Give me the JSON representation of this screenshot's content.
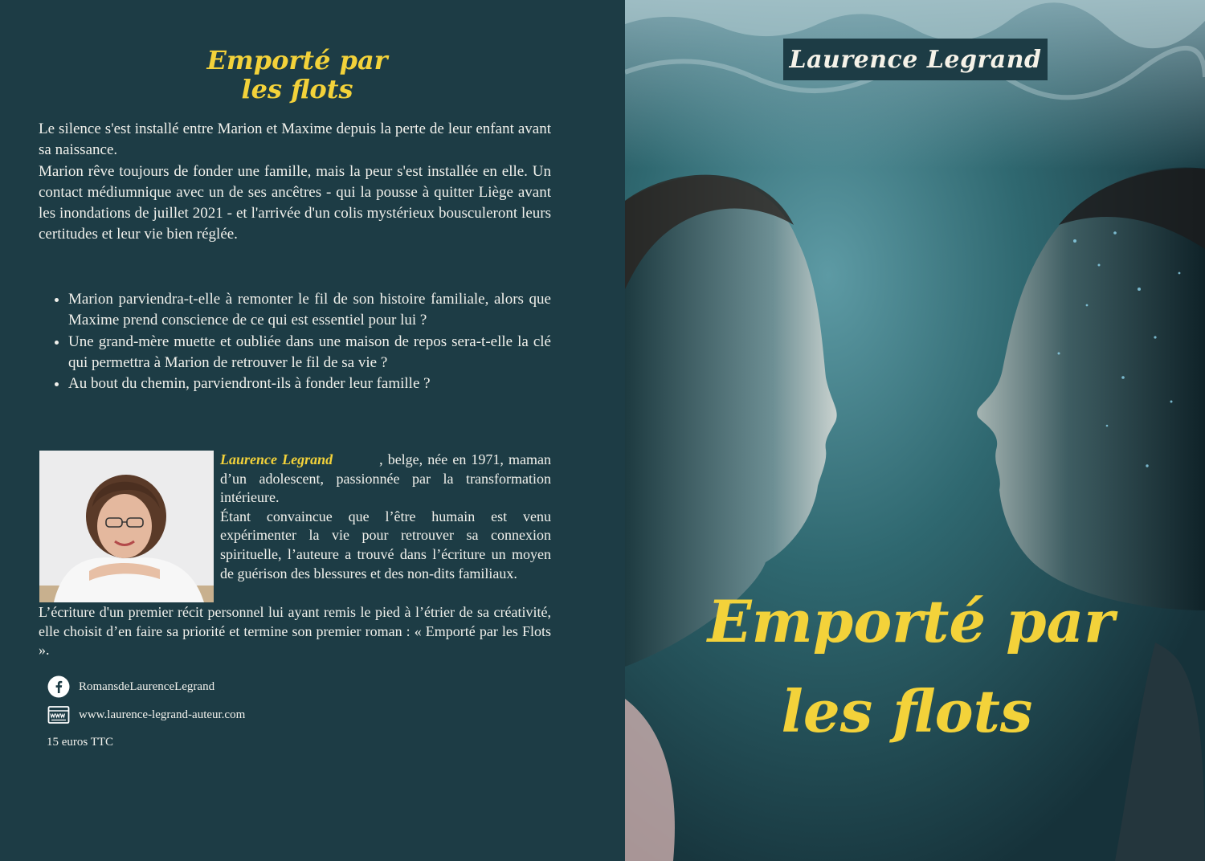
{
  "back": {
    "title_line1": "Emporté par",
    "title_line2": "les flots",
    "synopsis_p1": "Le silence s'est installé entre Marion et Maxime depuis la perte de leur enfant avant sa naissance.",
    "synopsis_p2": "Marion rêve toujours de fonder une famille, mais la peur s'est installée en elle. Un contact médiumnique avec un de ses ancêtres - qui la pousse à quitter Liège avant les inondations de juillet 2021 - et l'arrivée d'un colis mystérieux bousculeront leurs certitudes et leur vie bien réglée.",
    "questions": [
      "Marion parviendra-t-elle à remonter le fil de son histoire familiale, alors que Maxime prend conscience de ce qui est essentiel pour lui ?",
      "Une grand-mère muette et oubliée dans une maison de repos sera-t-elle la clé qui permettra à Marion de retrouver le fil de sa vie ?",
      "Au bout du chemin, parviendront-ils à fonder leur famille ?"
    ],
    "bio_name": "Laurence Legrand",
    "bio_intro": ", belge, née en 1971, maman d’un adolescent, passionnée par la transformation intérieure.",
    "bio_p2": "Étant convaincue que l’être humain est venu expérimenter la vie pour retrouver sa connexion spirituelle, l’auteure a trouvé dans l’écriture un moyen de guérison des blessures et des non-dits familiaux.",
    "bio_p3": "L’écriture d'un premier récit personnel lui ayant remis le pied à l’étrier de sa créativité, elle choisit d’en faire sa priorité et termine son premier roman : « Emporté par les Flots ».",
    "facebook": "RomansdeLaurenceLegrand",
    "website": "www.laurence-legrand-auteur.com",
    "price": "15 euros TTC"
  },
  "front": {
    "author": "Laurence Legrand",
    "title_line1": "Emporté par",
    "title_line2": "les flots"
  },
  "colors": {
    "background": "#1d3c45",
    "accent_yellow": "#f3d23a",
    "text": "#f1f1ec"
  },
  "icons": {
    "facebook": "facebook-icon",
    "website": "www-browser-icon"
  }
}
